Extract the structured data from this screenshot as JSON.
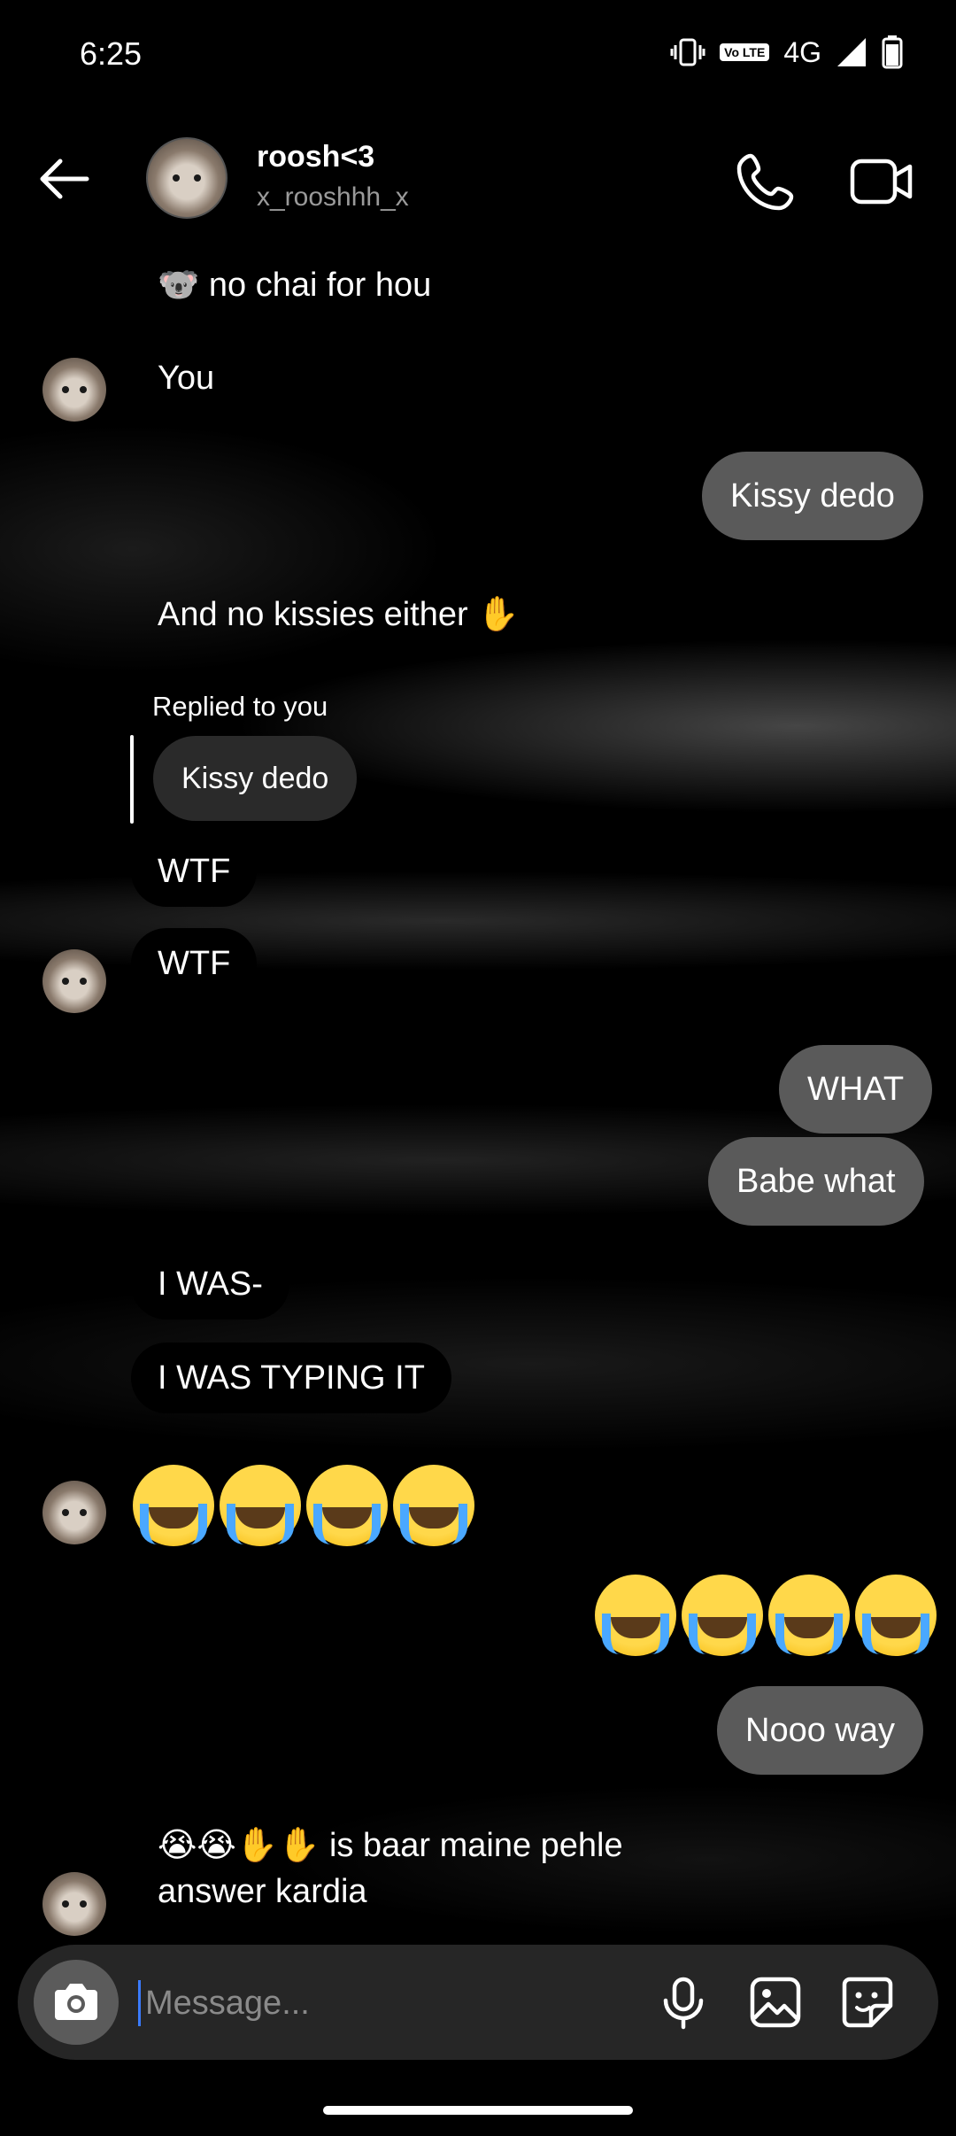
{
  "status_bar": {
    "time": "6:25",
    "network": "4G",
    "volte": "Vo LTE"
  },
  "header": {
    "name": "roosh<3",
    "username": "x_rooshhh_x"
  },
  "messages": {
    "m1": "🐨 no chai for hou",
    "m2": "You",
    "m3": "Kissy dedo",
    "m4": "And no kissies either ✋",
    "reply_label": "Replied to you",
    "m5_quoted": "Kissy dedo",
    "m6": "WTF",
    "m7": "WTF",
    "m8": "WHAT",
    "m9": "Babe what",
    "m10": "I WAS-",
    "m11": "I WAS TYPING IT",
    "m12_emoji": "😭😭😭😭",
    "m13_emoji": "😭😭😭😭",
    "m14": "Nooo way",
    "m15_line1": "😭😭✋✋ is baar maine pehle",
    "m15_line2": "answer kardia"
  },
  "composer": {
    "placeholder": "Message..."
  },
  "colors": {
    "outgoing_bubble": "#5a5a5a",
    "composer_bg": "#262626",
    "cursor": "#3a7bff"
  },
  "icons": [
    "back-arrow-icon",
    "phone-icon",
    "video-call-icon",
    "camera-icon",
    "microphone-icon",
    "gallery-icon",
    "sticker-icon"
  ]
}
